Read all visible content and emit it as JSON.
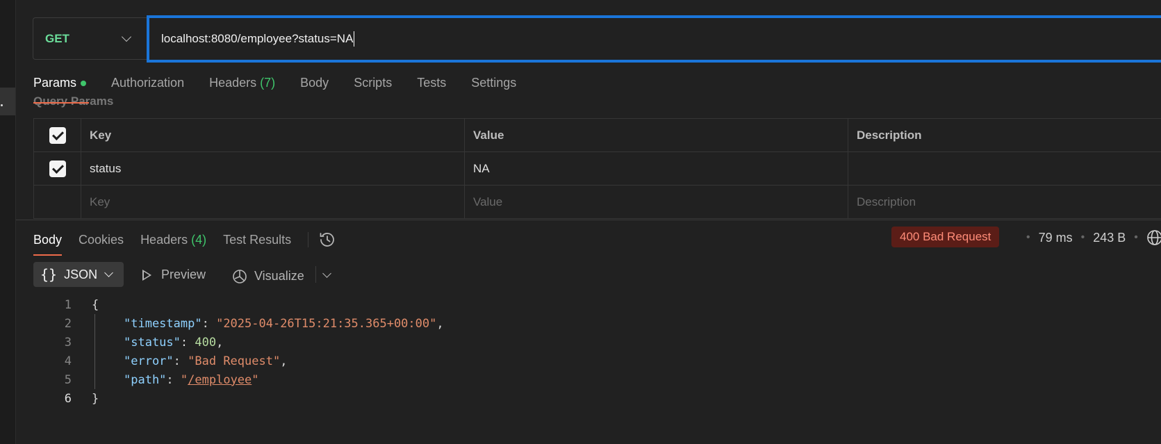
{
  "request": {
    "method": "GET",
    "url": "localhost:8080/employee?status=NA"
  },
  "request_tabs": {
    "params": "Params",
    "authorization": "Authorization",
    "headers": "Headers",
    "headers_count": "(7)",
    "body": "Body",
    "scripts": "Scripts",
    "tests": "Tests",
    "settings": "Settings"
  },
  "query_params": {
    "section_title": "Query Params",
    "headers": {
      "key": "Key",
      "value": "Value",
      "description": "Description"
    },
    "rows": [
      {
        "checked": true,
        "key": "status",
        "value": "NA",
        "description": ""
      }
    ],
    "placeholders": {
      "key": "Key",
      "value": "Value",
      "description": "Description"
    }
  },
  "response_tabs": {
    "body": "Body",
    "cookies": "Cookies",
    "headers": "Headers",
    "headers_count": "(4)",
    "test_results": "Test Results"
  },
  "response_meta": {
    "status": "400 Bad Request",
    "time": "79 ms",
    "size": "243 B",
    "status_color": "#ff8c78"
  },
  "body_toolbar": {
    "format": "JSON",
    "preview": "Preview",
    "visualize": "Visualize"
  },
  "response_body": {
    "lines": {
      "l1": "{",
      "l2_key": "\"timestamp\"",
      "l2_val": "\"2025-04-26T15:21:35.365+00:00\"",
      "l3_key": "\"status\"",
      "l3_val": "400",
      "l4_key": "\"error\"",
      "l4_val": "\"Bad Request\"",
      "l5_key": "\"path\"",
      "l5_q": "\"",
      "l5_val": "/employee",
      "l6": "}"
    },
    "line_numbers": [
      "1",
      "2",
      "3",
      "4",
      "5",
      "6"
    ]
  },
  "icons": [
    "chevron-down-icon",
    "checkbox-checked-icon",
    "history-icon",
    "globe-icon",
    "play-icon",
    "visualize-icon"
  ],
  "colors": {
    "accent": "#ee6b4a",
    "url_focus": "#1a75d9",
    "method_get": "#6bdd9a",
    "green": "#3fc56b"
  }
}
